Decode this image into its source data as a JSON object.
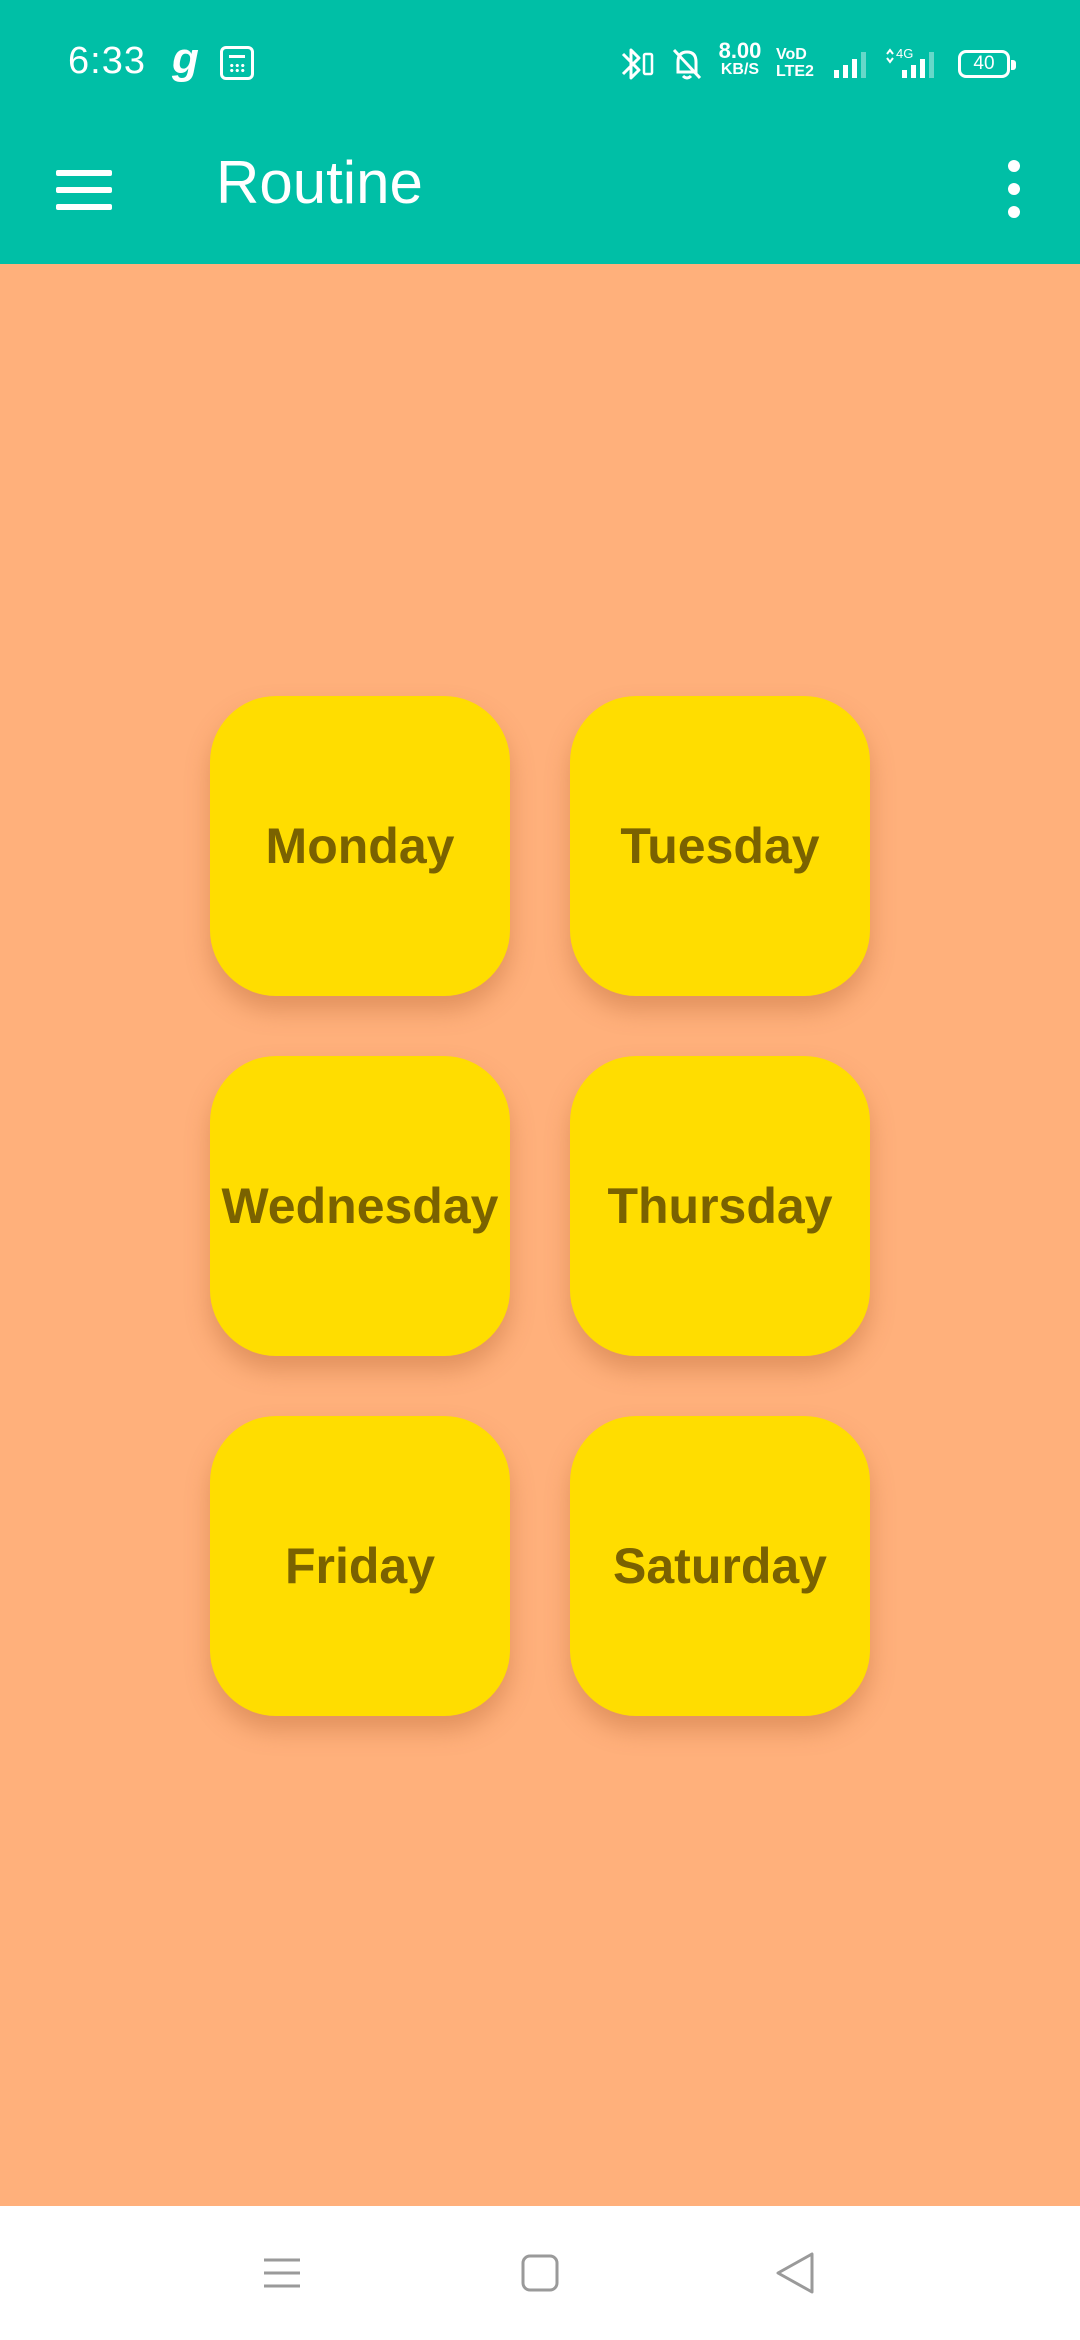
{
  "status_bar": {
    "time": "6:33",
    "g_icon": "g",
    "net_speed_value": "8.00",
    "net_speed_unit": "KB/S",
    "volte_line1": "VoD",
    "volte_line2": "LTE2",
    "signal_tag": "4G",
    "battery": "40",
    "icons": [
      "calculator-icon",
      "bluetooth-icon",
      "mute-icon",
      "signal-icon",
      "signal-4g-icon",
      "battery-icon"
    ]
  },
  "app_bar": {
    "title": "Routine",
    "menu_icon": "hamburger-menu-icon",
    "overflow_icon": "more-vertical-icon",
    "color": "#00BFA6"
  },
  "main": {
    "background": "#FFB07B",
    "card_color": "#FFDD00",
    "label_color": "#7A6200",
    "days": [
      {
        "label": "Monday"
      },
      {
        "label": "Tuesday"
      },
      {
        "label": "Wednesday"
      },
      {
        "label": "Thursday"
      },
      {
        "label": "Friday"
      },
      {
        "label": "Saturday"
      }
    ]
  },
  "nav_bar": {
    "buttons": [
      "recents-icon",
      "home-icon",
      "back-icon"
    ]
  }
}
